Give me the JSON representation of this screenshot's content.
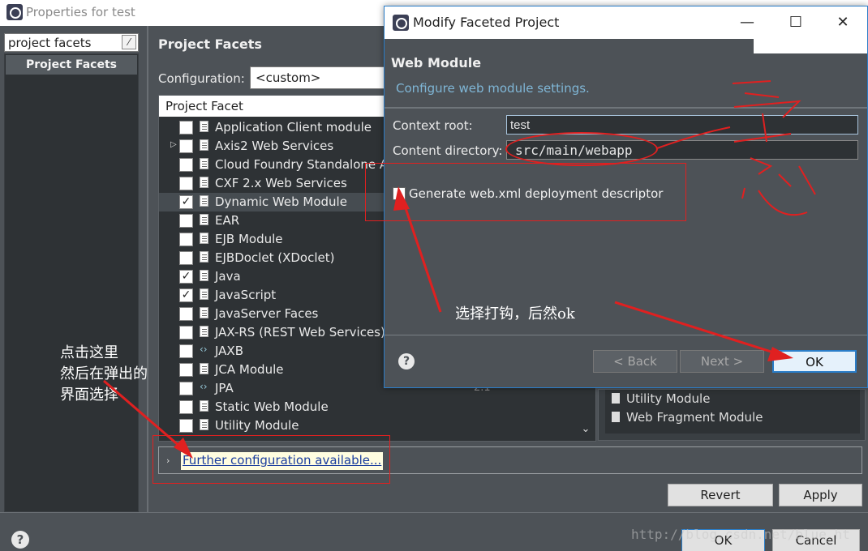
{
  "background_window": {
    "title": "Properties for test",
    "filter_value": "project facets",
    "nav_selected": "Project Facets",
    "page_title": "Project Facets",
    "configuration_label": "Configuration:",
    "configuration_value": "<custom>",
    "table_header": "Project Facet",
    "facets": [
      {
        "label": "Application Client module",
        "checked": false,
        "expandable": false,
        "icon": "page-icon"
      },
      {
        "label": "Axis2 Web Services",
        "checked": false,
        "expandable": true,
        "icon": "page-icon"
      },
      {
        "label": "Cloud Foundry Standalone A",
        "checked": false,
        "expandable": false,
        "icon": "page-icon"
      },
      {
        "label": "CXF 2.x Web Services",
        "checked": false,
        "expandable": false,
        "icon": "page-icon"
      },
      {
        "label": "Dynamic Web Module",
        "checked": true,
        "expandable": false,
        "icon": "globe-icon",
        "highlight": true
      },
      {
        "label": "EAR",
        "checked": false,
        "expandable": false,
        "icon": "page-icon"
      },
      {
        "label": "EJB Module",
        "checked": false,
        "expandable": false,
        "icon": "page-icon"
      },
      {
        "label": "EJBDoclet (XDoclet)",
        "checked": false,
        "expandable": false,
        "icon": "page-icon"
      },
      {
        "label": "Java",
        "checked": true,
        "expandable": false,
        "icon": "page-icon"
      },
      {
        "label": "JavaScript",
        "checked": true,
        "expandable": false,
        "icon": "page-icon"
      },
      {
        "label": "JavaServer Faces",
        "checked": false,
        "expandable": false,
        "icon": "page-icon"
      },
      {
        "label": "JAX-RS (REST Web Services)",
        "checked": false,
        "expandable": false,
        "icon": "page-icon"
      },
      {
        "label": "JAXB",
        "checked": false,
        "expandable": false,
        "icon": "jaxb-icon"
      },
      {
        "label": "JCA Module",
        "checked": false,
        "expandable": false,
        "icon": "page-icon"
      },
      {
        "label": "JPA",
        "checked": false,
        "expandable": false,
        "icon": "jpa-icon"
      },
      {
        "label": "Static Web Module",
        "checked": false,
        "expandable": false,
        "icon": "page-icon"
      },
      {
        "label": "Utility Module",
        "checked": false,
        "expandable": false,
        "icon": "page-icon"
      }
    ],
    "jpa_version": "2.1",
    "side_list": [
      "Utility Module",
      "Web Fragment Module"
    ],
    "further_link": "Further configuration available...",
    "revert_button": "Revert",
    "apply_button": "Apply",
    "ok_button": "OK",
    "cancel_button": "Cancel"
  },
  "modal": {
    "title": "Modify Faceted Project",
    "header_title": "Web Module",
    "header_subtitle": "Configure web module settings.",
    "context_root_label": "Context root:",
    "context_root_value": "test",
    "content_dir_label": "Content directory:",
    "content_dir_value": "src/main/webapp",
    "generate_label": "Generate web.xml deployment descriptor",
    "generate_checked": false,
    "back_button": "< Back",
    "next_button": "Next >",
    "ok_button": "OK"
  },
  "annotations": {
    "left_note_lines": [
      "点击这里",
      "然后在弹出的",
      "界面选择"
    ],
    "mid_note": "选择打钩，后然ok",
    "handwritten": "注意",
    "watermark": "http://blog.csdn.net/blue_ht"
  }
}
